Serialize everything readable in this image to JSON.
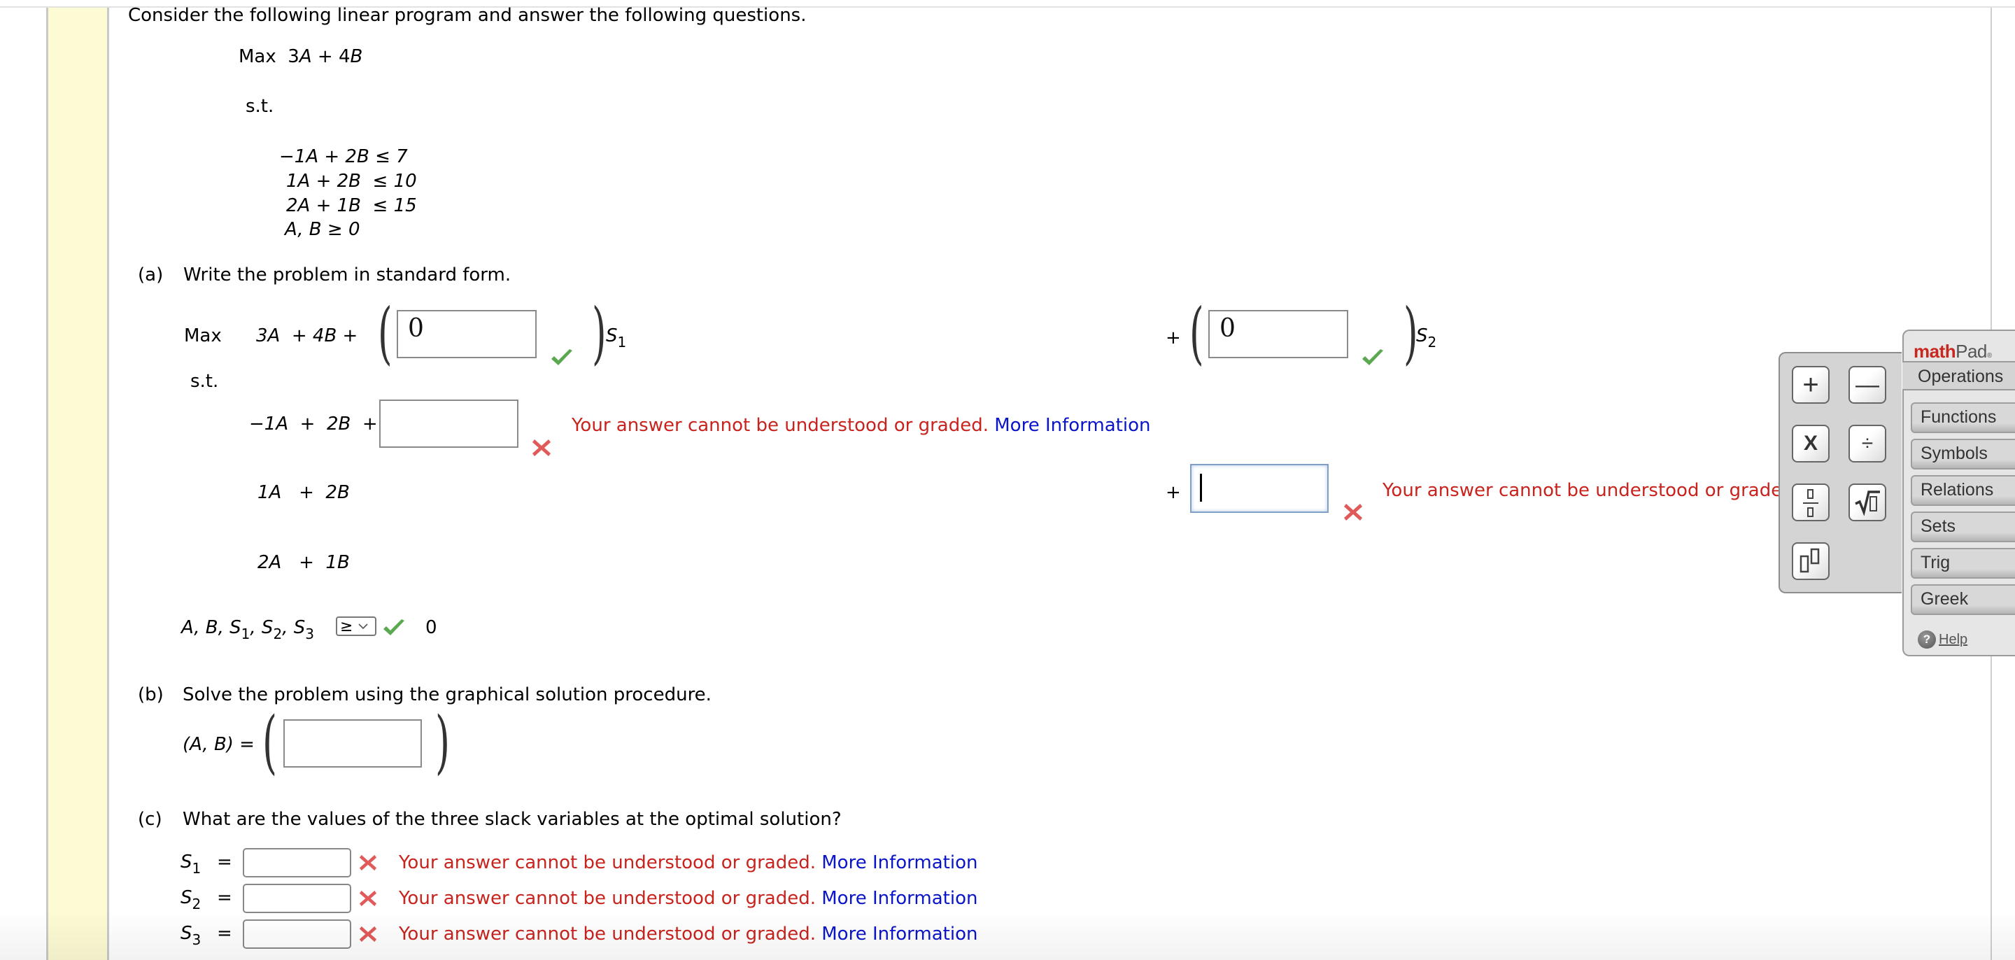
{
  "intro": "Consider the following linear program and answer the following questions.",
  "problem": {
    "objective_prefix": "Max",
    "objective": [
      "3",
      "A",
      " + 4",
      "B"
    ],
    "st_label": "s.t.",
    "constraints": [
      {
        "text": "−1A + 2B ≤ 7"
      },
      {
        "text": "1A + 2B  ≤ 10"
      },
      {
        "text": "2A + 1B  ≤ 15"
      },
      {
        "text": "A, B ≥ 0"
      }
    ]
  },
  "part_a": {
    "label": "(a)",
    "question": "Write the problem in standard form.",
    "max_label": "Max",
    "objective_terms": "3A  + 4B +",
    "s1_coef_value": "0",
    "s1_status": "correct",
    "s1_var": "S",
    "s1_sub": "1",
    "s2_plus": "+",
    "s2_coef_value": "0",
    "s2_status": "correct",
    "s2_var": "S",
    "s2_sub": "2",
    "st_label": "s.t.",
    "rows": [
      {
        "lhs": "−1A  +  2B  +",
        "input_value": "",
        "status": "incorrect",
        "error": "Your answer cannot be understood or graded.",
        "link": "More Information"
      },
      {
        "lhs": "1A   +  2B",
        "plus": "+",
        "input_value": "",
        "focused": true,
        "status": "incorrect",
        "error": "Your answer cannot be understood or graded."
      },
      {
        "lhs": "2A   +  1B"
      }
    ],
    "nonneg_vars": "A, B, S",
    "nonneg_subs": [
      "1",
      "2",
      "3"
    ],
    "nonneg_select": "≥",
    "nonneg_status": "correct",
    "nonneg_rhs": "0"
  },
  "part_b": {
    "label": "(b)",
    "question": "Solve the problem using the graphical solution procedure.",
    "lhs": "(A, B) =",
    "input_value": ""
  },
  "part_c": {
    "label": "(c)",
    "question": "What are the values of the three slack variables at the optimal solution?",
    "rows": [
      {
        "var": "S",
        "sub": "1",
        "eq": "=",
        "value": "",
        "status": "incorrect",
        "error": "Your answer cannot be understood or graded.",
        "link": "More Information"
      },
      {
        "var": "S",
        "sub": "2",
        "eq": "=",
        "value": "",
        "status": "incorrect",
        "error": "Your answer cannot be understood or graded.",
        "link": "More Information"
      },
      {
        "var": "S",
        "sub": "3",
        "eq": "=",
        "value": "",
        "status": "incorrect",
        "error": "Your answer cannot be understood or graded.",
        "link": "More Information"
      }
    ]
  },
  "mathpad": {
    "logo_main": "math",
    "logo_rest": "Pad",
    "logo_mark": "®",
    "active_tab": "Operations",
    "tabs": [
      "Functions",
      "Symbols",
      "Relations",
      "Sets",
      "Trig",
      "Greek"
    ],
    "help": "Help",
    "operations": [
      {
        "name": "plus",
        "glyph": "+"
      },
      {
        "name": "minus",
        "glyph": "—"
      },
      {
        "name": "times",
        "glyph": "X"
      },
      {
        "name": "divide",
        "glyph": "÷"
      },
      {
        "name": "fraction",
        "glyph": "fraction"
      },
      {
        "name": "sqrt",
        "glyph": "√"
      },
      {
        "name": "exponent",
        "glyph": "exponent"
      }
    ]
  },
  "colors": {
    "error": "#c8231d",
    "link": "#0a14c8",
    "check": "#5aa84f",
    "x_mark": "#e05a5a",
    "sidebar": "#fdfbd3",
    "mathpad_logo": "#c7281f"
  }
}
